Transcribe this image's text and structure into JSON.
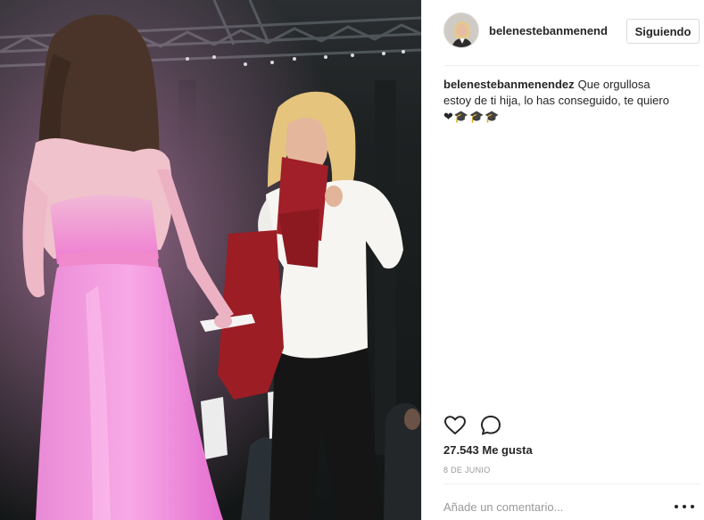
{
  "post": {
    "username": "belenestebanmenend",
    "follow_label": "Siguiendo",
    "caption": {
      "username": "belenestebanmenendez",
      "text": "Que orgullosa estoy de ti hija, lo has conseguido, te quiero",
      "emoji": "❤🎓🎓🎓"
    },
    "likes": "27.543 Me gusta",
    "date": "8 DE JUNIO",
    "comment_placeholder": "Añade un comentario..."
  },
  "icons": {
    "like": "heart-icon",
    "comment": "speech-bubble-icon",
    "more": "more-options-icon"
  },
  "colors": {
    "text": "#262626",
    "muted": "#999999",
    "border": "#dbdbdb"
  }
}
